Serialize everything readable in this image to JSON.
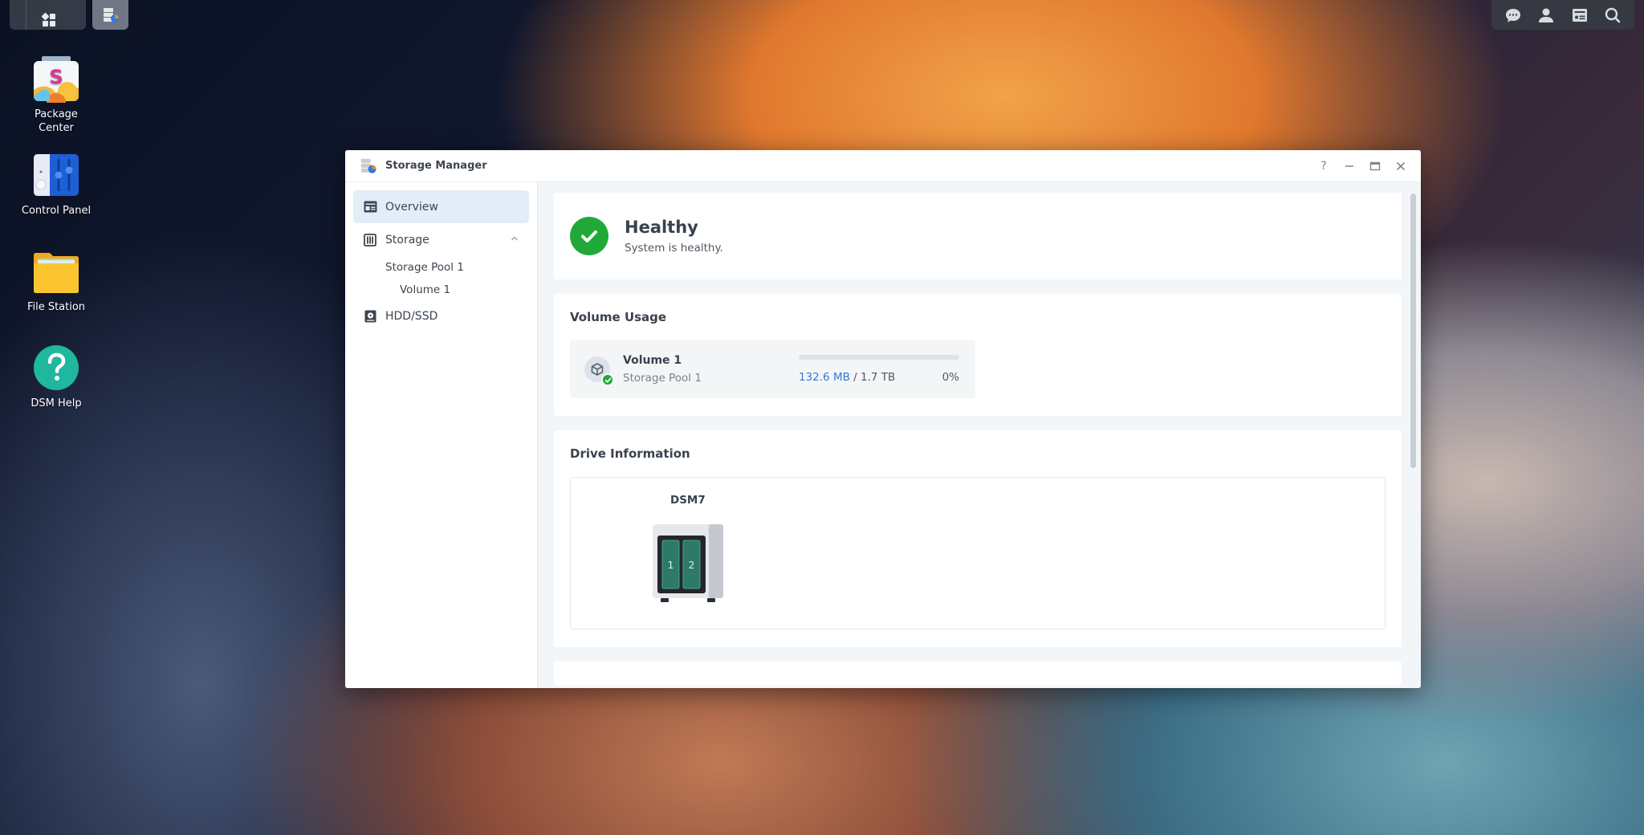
{
  "taskbar": {
    "main_menu_icon": "grid-menu-icon",
    "open_app_icon": "storage-manager-icon",
    "right_icons": [
      "chat-icon",
      "user-icon",
      "widgets-icon",
      "search-icon"
    ]
  },
  "desktop": {
    "icons": [
      {
        "label": "Package\nCenter",
        "line1": "Package",
        "line2": "Center",
        "icon": "package-center-icon"
      },
      {
        "label": "Control Panel",
        "icon": "control-panel-icon"
      },
      {
        "label": "File Station",
        "icon": "file-station-icon"
      },
      {
        "label": "DSM Help",
        "icon": "dsm-help-icon"
      }
    ]
  },
  "window": {
    "title": "Storage Manager",
    "controls": [
      "help",
      "minimize",
      "maximize",
      "close"
    ],
    "help_glyph": "?",
    "sidebar": {
      "items": [
        {
          "label": "Overview",
          "icon": "overview-icon",
          "active": true
        },
        {
          "label": "Storage",
          "icon": "storage-icon",
          "expanded": true,
          "children": [
            {
              "label": "Storage Pool 1",
              "children": [
                {
                  "label": "Volume 1"
                }
              ]
            }
          ]
        },
        {
          "label": "HDD/SSD",
          "icon": "hdd-icon"
        }
      ]
    },
    "health": {
      "title": "Healthy",
      "subtitle": "System is healthy.",
      "color": "#21a938"
    },
    "volume_usage": {
      "title": "Volume Usage",
      "volumes": [
        {
          "name": "Volume 1",
          "pool": "Storage Pool 1",
          "used": "132.6 MB",
          "separator": " / ",
          "total": "1.7 TB",
          "percent_label": "0%",
          "percent": 0,
          "status": "healthy"
        }
      ]
    },
    "drive_info": {
      "title": "Drive Information",
      "device_name": "DSM7",
      "bays": [
        "1",
        "2"
      ]
    }
  },
  "colors": {
    "accent": "#2d7dd2",
    "healthy": "#21a938",
    "active_nav": "#e3edf9"
  }
}
